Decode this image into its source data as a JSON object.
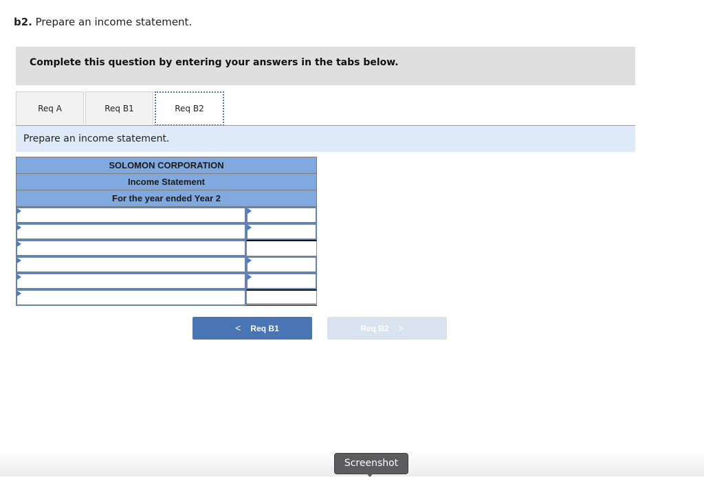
{
  "question": {
    "number": "b2.",
    "text": " Prepare an income statement."
  },
  "instructions": "Complete this question by entering your answers in the tabs below.",
  "tabs": [
    {
      "label": "Req A",
      "active": false
    },
    {
      "label": "Req B1",
      "active": false
    },
    {
      "label": "Req B2",
      "active": true
    }
  ],
  "prompt": "Prepare an income statement.",
  "statement": {
    "company": "SOLOMON CORPORATION",
    "title": "Income Statement",
    "period": "For the year ended Year 2",
    "rows": [
      {
        "label": "",
        "value": "",
        "label_dropdown": true,
        "value_dropdown": true,
        "value_style": "normal"
      },
      {
        "label": "",
        "value": "",
        "label_dropdown": true,
        "value_dropdown": true,
        "value_style": "normal"
      },
      {
        "label": "",
        "value": "",
        "label_dropdown": true,
        "value_dropdown": false,
        "value_style": "total"
      },
      {
        "label": "",
        "value": "",
        "label_dropdown": true,
        "value_dropdown": true,
        "value_style": "normal"
      },
      {
        "label": "",
        "value": "",
        "label_dropdown": true,
        "value_dropdown": true,
        "value_style": "normal"
      },
      {
        "label": "",
        "value": "",
        "label_dropdown": true,
        "value_dropdown": false,
        "value_style": "grand"
      }
    ]
  },
  "navigation": {
    "prev_label": "Req B1",
    "prev_icon": "chevron-left-icon",
    "next_label": "Req B2",
    "next_icon": "chevron-right-icon",
    "next_disabled": true
  },
  "tooltip": "Screenshot",
  "colors": {
    "header_blue": "#80aadf",
    "nav_blue": "#4a75b4",
    "prompt_bg": "#deeaf7",
    "instr_bg": "#dfdfdf"
  }
}
